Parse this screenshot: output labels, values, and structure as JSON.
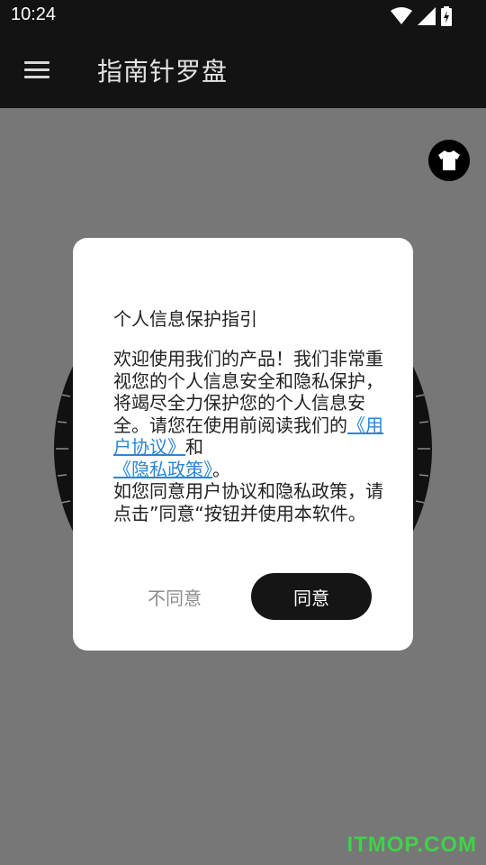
{
  "status_bar": {
    "time": "10:24",
    "icons": [
      "wifi-icon",
      "signal-icon",
      "battery-charging-icon"
    ]
  },
  "app_bar": {
    "title": "指南针罗盘",
    "menu_icon": "hamburger-menu-icon"
  },
  "main": {
    "skin_button_icon": "tshirt-icon"
  },
  "dialog": {
    "title": "个人信息保护指引",
    "body_intro": "欢迎使用我们的产品！我们非常重视您的个人信息安全和隐私保护，将竭尽全力保护您的个人信息安全。请您在使用前阅读我们的",
    "user_agreement_link": "《用户协议》",
    "and_text": "和",
    "privacy_policy_link": "《隐私政策》",
    "period": "。",
    "body_outro": " 如您同意用户协议和隐私政策，请点击”同意“按钮并使用本软件。",
    "disagree_label": "不同意",
    "agree_label": "同意"
  },
  "watermark": "ITMOP.COM",
  "colors": {
    "bar_bg": "#131313",
    "overlay_bg": "#777777",
    "link": "#2a86d6",
    "agree_button_bg": "#151515",
    "watermark": "#3fd24a"
  }
}
